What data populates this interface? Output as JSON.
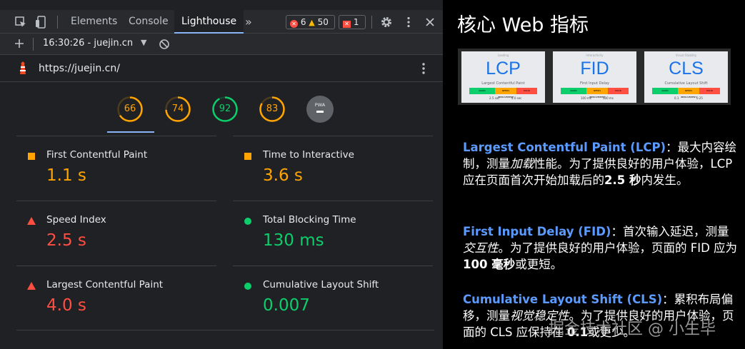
{
  "devtools": {
    "tabs": [
      {
        "label": "Elements"
      },
      {
        "label": "Console"
      },
      {
        "label": "Lighthouse"
      }
    ],
    "more_tabs_label": "»",
    "errors_count": "6",
    "warnings_count": "50",
    "issues_count": "1",
    "report_selector": "16:30:26 - juejin.cn",
    "url": "https://juejin.cn/",
    "scores": [
      {
        "value": "66",
        "fraction": 0.66,
        "color": "#ffa400"
      },
      {
        "value": "74",
        "fraction": 0.74,
        "color": "#ffa400"
      },
      {
        "value": "92",
        "fraction": 0.92,
        "color": "#0cce6b"
      },
      {
        "value": "83",
        "fraction": 0.83,
        "color": "#ffa400"
      }
    ],
    "pwa_label": "PWA",
    "metrics": [
      {
        "label": "First Contentful Paint",
        "value": "1.1 s",
        "status": "average",
        "color": "#ffa400"
      },
      {
        "label": "Time to Interactive",
        "value": "3.6 s",
        "status": "average",
        "color": "#ffa400"
      },
      {
        "label": "Speed Index",
        "value": "2.5 s",
        "status": "fail",
        "color": "#ff4e42"
      },
      {
        "label": "Total Blocking Time",
        "value": "130 ms",
        "status": "pass",
        "color": "#0cce6b"
      },
      {
        "label": "Largest Contentful Paint",
        "value": "4.0 s",
        "status": "fail",
        "color": "#ff4e42"
      },
      {
        "label": "Cumulative Layout Shift",
        "value": "0.007",
        "status": "pass",
        "color": "#0cce6b"
      }
    ]
  },
  "slide": {
    "title": "核心 Web 指标",
    "cards": [
      {
        "caption": "Loading",
        "abbr": "LCP",
        "subtitle": "Largest Contentful Paint",
        "good": "GOOD",
        "mid": "NEEDS IMPROVEMENT",
        "poor": "POOR",
        "t1": "2.5 sec",
        "t2": "4.0 sec"
      },
      {
        "caption": "Interactivity",
        "abbr": "FID",
        "subtitle": "First Input Delay",
        "good": "GOOD",
        "mid": "NEEDS IMPROVEMENT",
        "poor": "POOR",
        "t1": "100 ms",
        "t2": "300 ms"
      },
      {
        "caption": "Visual Stability",
        "abbr": "CLS",
        "subtitle": "Cumulative Layout Shift",
        "good": "GOOD",
        "mid": "NEEDS IMPROVEMENT",
        "poor": "POOR",
        "t1": "0.1",
        "t2": "0.25"
      }
    ],
    "lcp": {
      "term": "Largest Contentful Paint (LCP)",
      "text1": "：最大内容绘制，测量",
      "em": "加载",
      "text2": "性能。为了提供良好的用户体验，LCP 应在页面首次开始加载后的",
      "strong": "2.5 秒",
      "text3": "内发生。"
    },
    "fid": {
      "term": "First Input Delay (FID)",
      "text1": "：首次输入延迟，测量",
      "em": "交互性",
      "text2": "。为了提供良好的用户体验，页面的 FID 应为",
      "strong": "100 毫秒",
      "text3": "或更短。"
    },
    "cls": {
      "term": "Cumulative Layout Shift (CLS)",
      "text1": "：累积布局偏移，测量",
      "em": "视觉稳定性",
      "text2": "。为了提供良好的用户体验，页面的 CLS 应保持在 ",
      "strong": "0.1",
      "text3": "或更少。"
    },
    "watermark": "掘金技术社区 @ 小生毕"
  },
  "colors": {
    "average": "#ffa400",
    "fail": "#ff4e42",
    "pass": "#0cce6b",
    "accent": "#8ab4f8",
    "term_blue": "#5b9bff"
  }
}
